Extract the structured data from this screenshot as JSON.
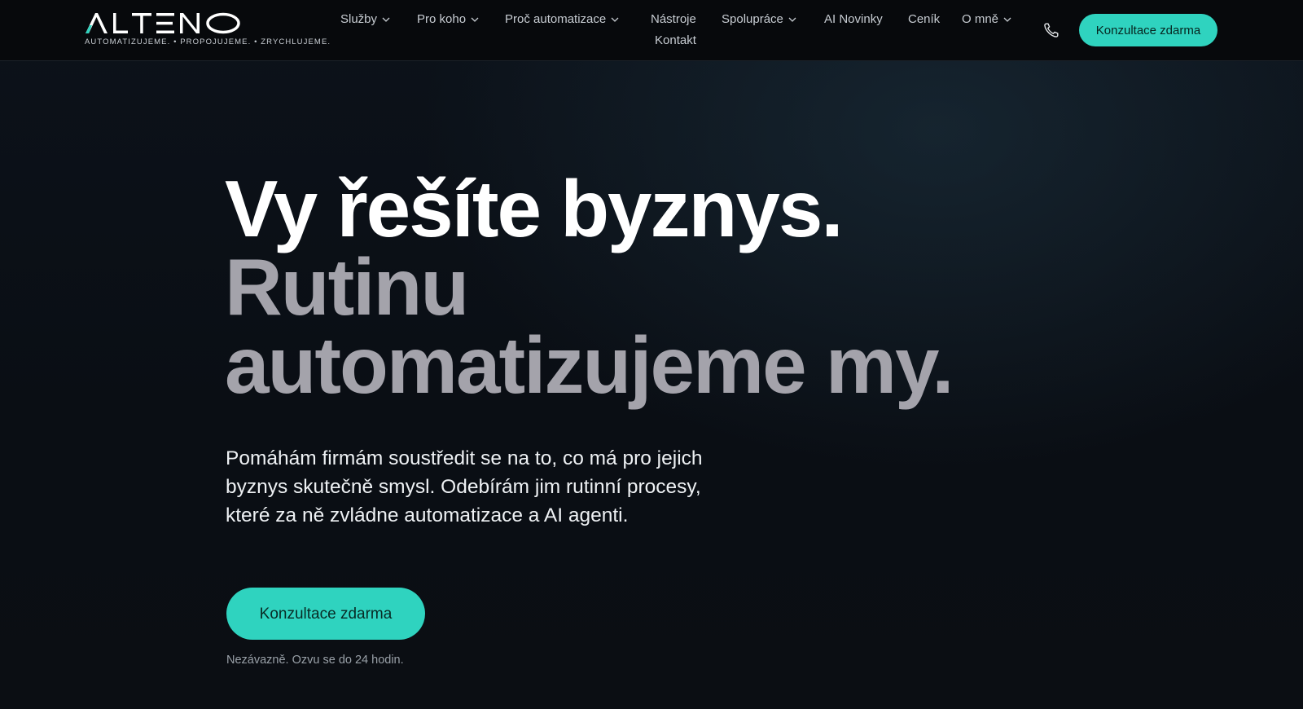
{
  "brand": {
    "name": "ALTENO",
    "tagline": "AUTOMATIZUJEME.  •  PROPOJUJEME.  •  ZRYCHLUJEME.",
    "accent_color": "#2fd3bf"
  },
  "nav": {
    "items": [
      {
        "label": "Služby",
        "has_dropdown": true
      },
      {
        "label": "Pro koho",
        "has_dropdown": true
      },
      {
        "label": "Proč automatizace",
        "has_dropdown": true
      },
      {
        "label": "Nástroje",
        "has_dropdown": false
      },
      {
        "label": "Spolupráce",
        "has_dropdown": true
      },
      {
        "label": "AI Novinky",
        "has_dropdown": false
      },
      {
        "label": "Ceník",
        "has_dropdown": false
      },
      {
        "label": "O mně",
        "has_dropdown": true
      },
      {
        "label": "Kontakt",
        "has_dropdown": false
      }
    ],
    "phone_icon": "phone-icon",
    "cta_label": "Konzultace zdarma"
  },
  "hero": {
    "title_line1": "Vy řešíte byznys.",
    "title_line2": "Rutinu",
    "title_line3": "automatizujeme my.",
    "subtitle": "Pomáhám firmám soustředit se na to, co má pro jejich byznys skutečně smysl. Odebírám jim rutinní procesy, které za ně zvládne automatizace a AI agenti.",
    "cta_label": "Konzultace zdarma",
    "cta_note": "Nezávazně. Ozvu se do 24 hodin."
  },
  "colors": {
    "background": "#0b0f14",
    "header_bg": "#07090c",
    "title_primary": "#ffffff",
    "title_secondary": "#a4a3ab",
    "button": "#2fd3bf"
  }
}
